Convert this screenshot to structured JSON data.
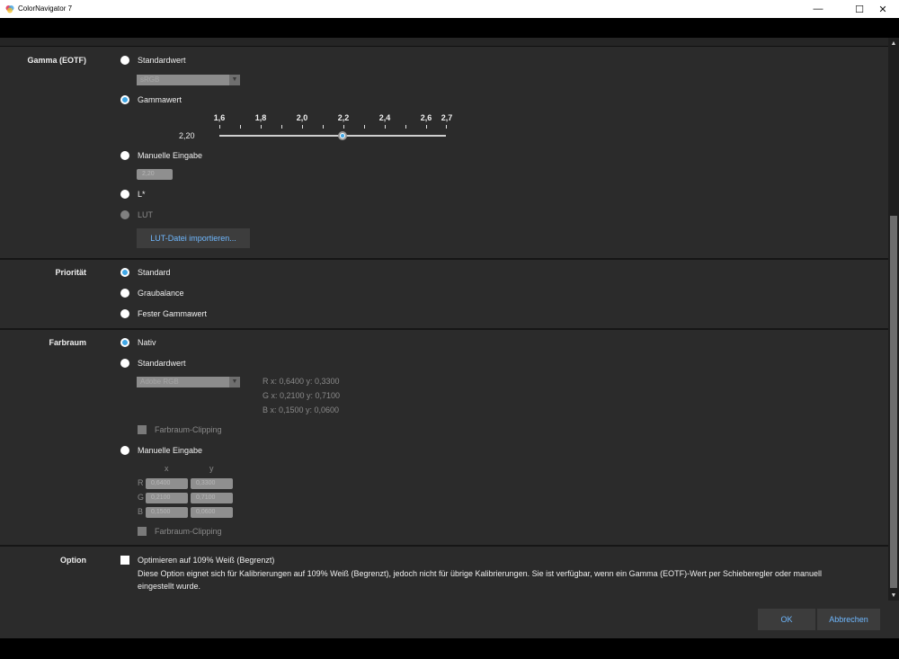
{
  "window": {
    "title": "ColorNavigator 7",
    "minimize": "—",
    "maximize": "☐",
    "close": "✕"
  },
  "gamma": {
    "label": "Gamma (EOTF)",
    "standard_label": "Standardwert",
    "standard_combo": "sRGB",
    "gammawert_label": "Gammawert",
    "ticks": [
      "1,6",
      "1,8",
      "2,0",
      "2,2",
      "2,4",
      "2,6",
      "2,7"
    ],
    "slider_min": 1.6,
    "slider_max": 2.7,
    "slider_value": 2.2,
    "value_display": "2,20",
    "manual_label": "Manuelle Eingabe",
    "manual_value": "2,20",
    "lstar_label": "L*",
    "lut_label": "LUT",
    "lut_button": "LUT-Datei importieren..."
  },
  "priority": {
    "label": "Priorität",
    "standard": "Standard",
    "graubalance": "Graubalance",
    "fester": "Fester Gammawert"
  },
  "colorspace": {
    "label": "Farbraum",
    "nativ": "Nativ",
    "standard_label": "Standardwert",
    "combo": "Adobe RGB",
    "coords": {
      "r": "R x: 0,6400  y: 0,3300",
      "g": "G x: 0,2100  y: 0,7100",
      "b": "B x: 0,1500  y: 0,0600"
    },
    "clipping1": "Farbraum-Clipping",
    "manual_label": "Manuelle Eingabe",
    "col_x": "x",
    "col_y": "y",
    "rows": [
      {
        "ch": "R",
        "x": "0,6400",
        "y": "0,3300"
      },
      {
        "ch": "G",
        "x": "0,2100",
        "y": "0,7100"
      },
      {
        "ch": "B",
        "x": "0,1500",
        "y": "0,0600"
      }
    ],
    "clipping2": "Farbraum-Clipping"
  },
  "option": {
    "label": "Option",
    "checkbox_label": "Optimieren auf 109% Weiß (Begrenzt)",
    "description": "Diese Option eignet sich für Kalibrierungen auf 109% Weiß (Begrenzt), jedoch nicht für übrige Kalibrierungen. Sie ist verfügbar, wenn ein Gamma (EOTF)-Wert per Schieberegler oder manuell eingestellt wurde."
  },
  "footer": {
    "ok": "OK",
    "cancel": "Abbrechen"
  },
  "colors": {
    "accent": "#3fa7e6",
    "link": "#6fb8ff",
    "panel": "#2b2b2b"
  }
}
